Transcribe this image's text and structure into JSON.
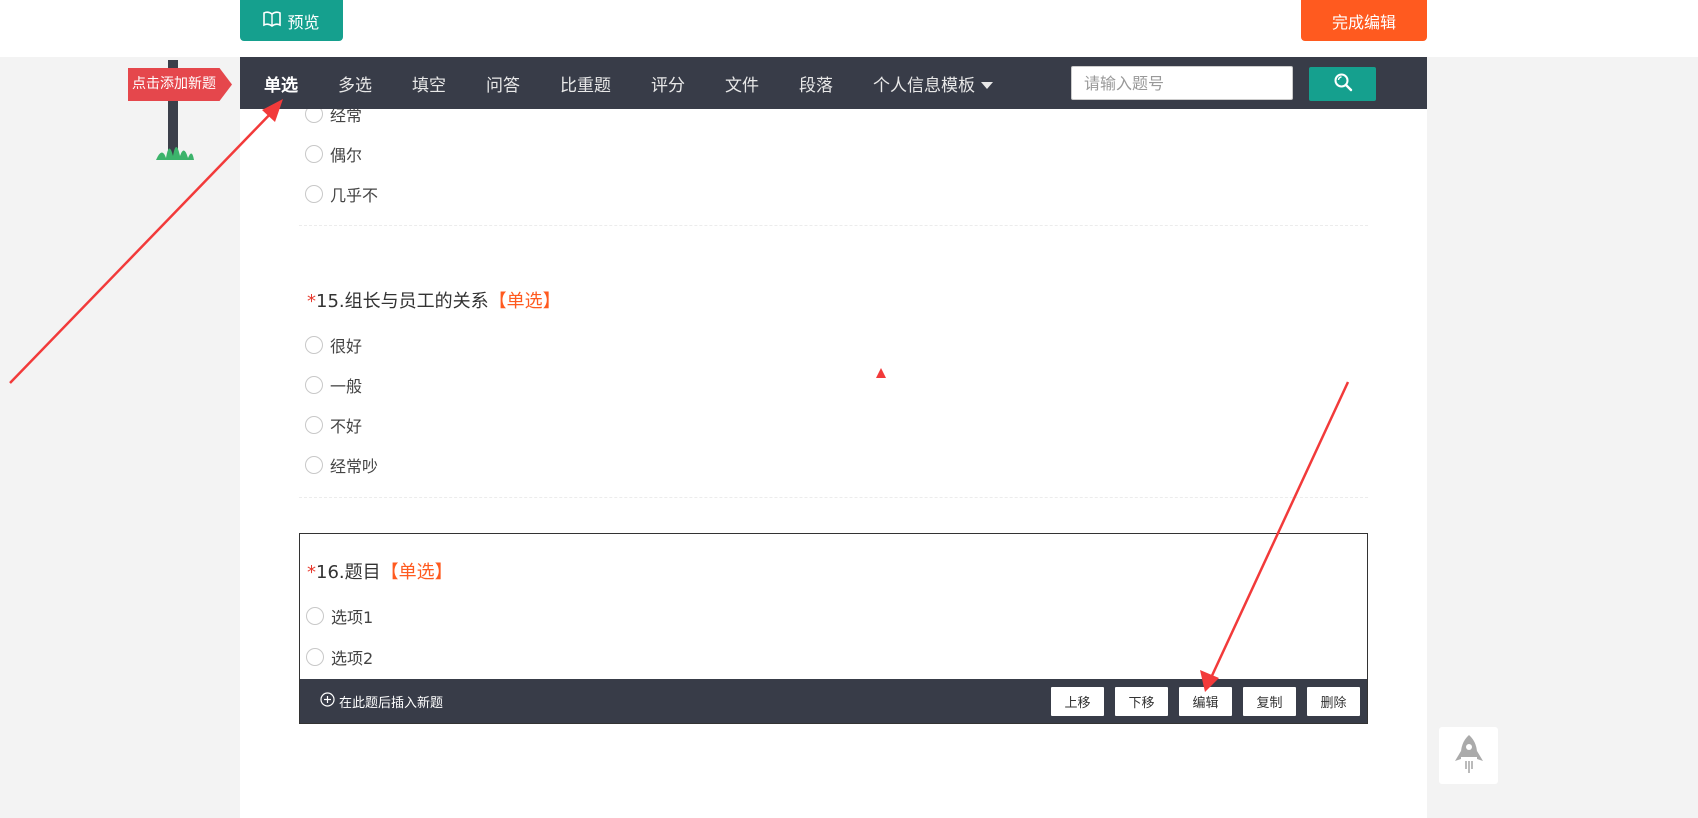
{
  "toolbar": {
    "preview_label": "预览",
    "finish_label": "完成编辑"
  },
  "nav": {
    "items": [
      {
        "label": "单选"
      },
      {
        "label": "多选"
      },
      {
        "label": "填空"
      },
      {
        "label": "问答"
      },
      {
        "label": "比重题"
      },
      {
        "label": "评分"
      },
      {
        "label": "文件"
      },
      {
        "label": "段落"
      },
      {
        "label": "个人信息模板"
      }
    ],
    "search_placeholder": "请输入题号"
  },
  "signpost": {
    "label": "点击添加新题"
  },
  "questions": [
    {
      "options": [
        "经常",
        "偶尔",
        "几乎不"
      ]
    },
    {
      "required_mark": "*",
      "title": "15.组长与员工的关系",
      "type_tag": "【单选】",
      "options": [
        "很好",
        "一般",
        "不好",
        "经常吵"
      ]
    },
    {
      "required_mark": "*",
      "title": "16.题目",
      "type_tag": "【单选】",
      "options": [
        "选项1",
        "选项2"
      ]
    }
  ],
  "question_actions": {
    "insert_label": "在此题后插入新题",
    "move_up": "上移",
    "move_down": "下移",
    "edit": "编辑",
    "copy": "复制",
    "delete": "删除"
  },
  "colors": {
    "teal": "#15a08e",
    "orange": "#ff5a1f",
    "nav_bg": "#383c48",
    "annotation_red": "#f23a3a"
  },
  "icons": [
    "book-icon",
    "search-icon",
    "plus-circle-icon",
    "rocket-icon"
  ]
}
